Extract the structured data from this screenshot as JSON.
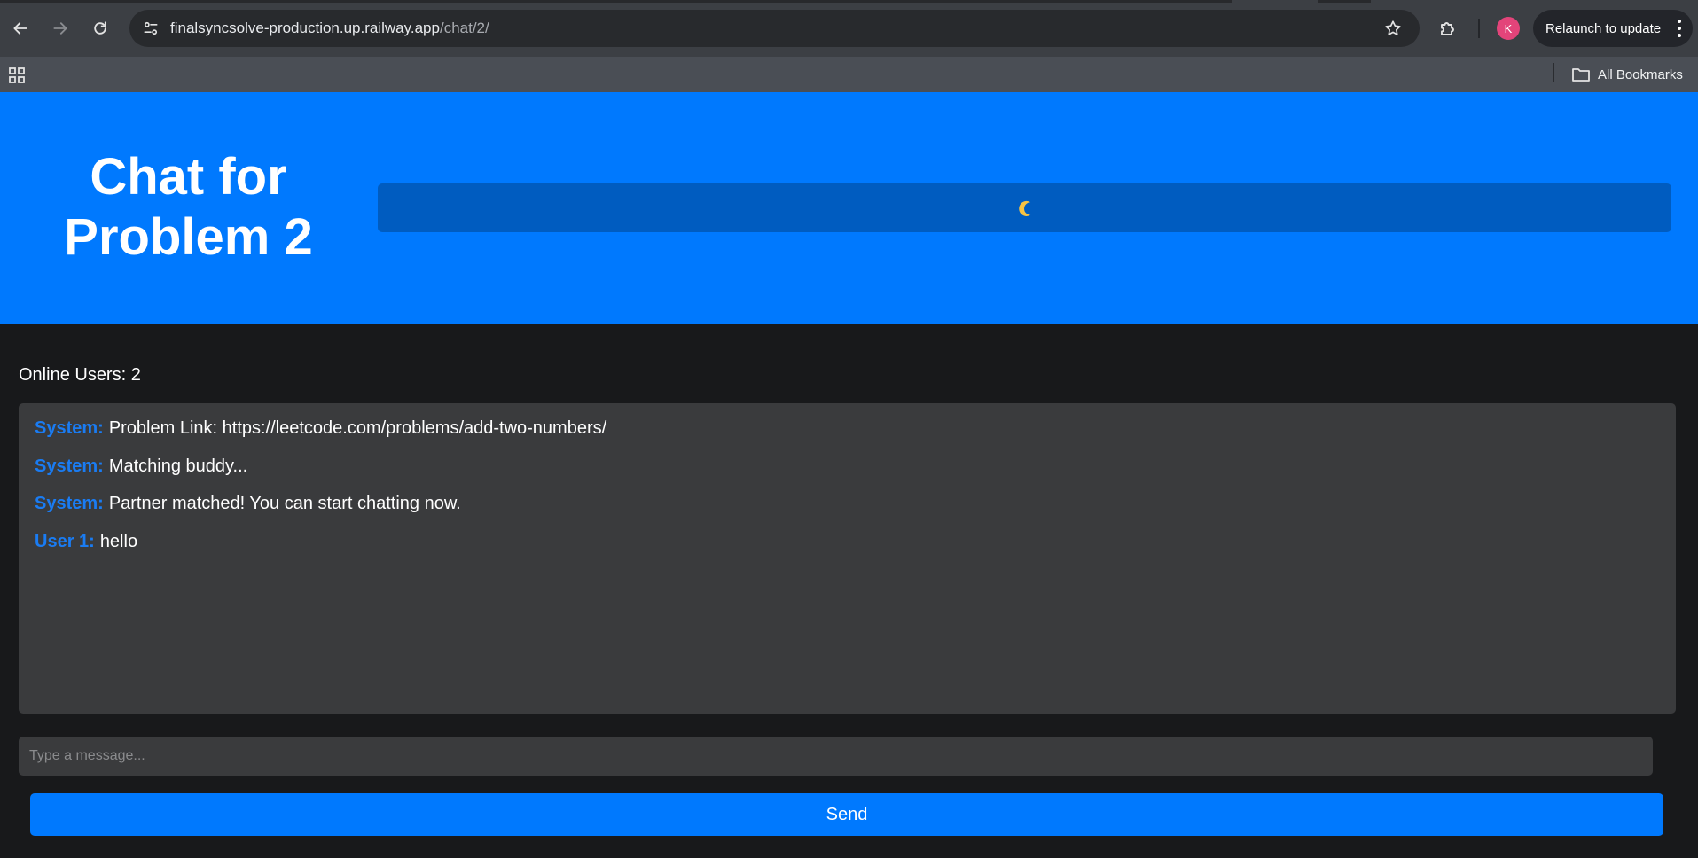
{
  "browser": {
    "url_host": "finalsyncsolve-production.up.railway.app",
    "url_path": "/chat/2/",
    "profile_initial": "K",
    "relaunch_label": "Relaunch to update",
    "bookmarks_label": "All Bookmarks",
    "icons": {
      "back": "back-arrow-icon",
      "forward": "forward-arrow-icon",
      "reload": "reload-icon",
      "site_info": "tune-icon",
      "bookmark_star": "star-icon",
      "extensions": "puzzle-icon",
      "menu": "kebab-menu-icon",
      "apps": "apps-grid-icon",
      "folder": "folder-icon"
    },
    "colors": {
      "avatar": "#e3447a"
    }
  },
  "page": {
    "title": "Chat for Problem 2",
    "theme_toggle_icon": "moon-icon",
    "online_users": "Online Users: 2",
    "messages": [
      {
        "sender": "System:",
        "text": "Problem Link: https://leetcode.com/problems/add-two-numbers/"
      },
      {
        "sender": "System:",
        "text": "Matching buddy..."
      },
      {
        "sender": "System:",
        "text": "Partner matched! You can start chatting now."
      },
      {
        "sender": "User 1:",
        "text": "hello"
      }
    ],
    "input": {
      "value": "",
      "placeholder": "Type a message..."
    },
    "send_label": "Send",
    "colors": {
      "accent": "#0079fe",
      "sender": "#1a7cf3",
      "toggle": "#005cc0",
      "background": "#18191b",
      "panel": "#3a3b3d"
    }
  }
}
